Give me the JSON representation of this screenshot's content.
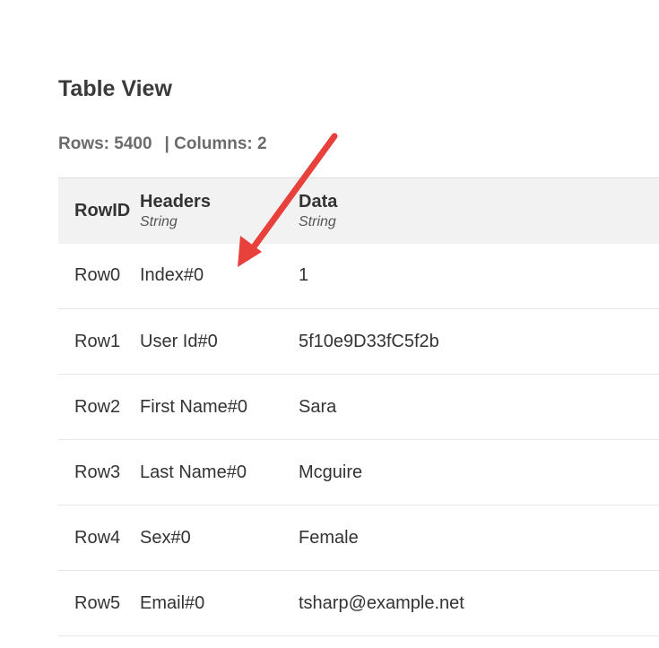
{
  "page": {
    "title": "Table View"
  },
  "summary": {
    "rows": "Rows: 5400",
    "columns": "| Columns: 2"
  },
  "table": {
    "columns": [
      {
        "label": "RowID",
        "type": ""
      },
      {
        "label": "Headers",
        "type": "String"
      },
      {
        "label": "Data",
        "type": "String"
      }
    ],
    "rows": [
      {
        "rowid": "Row0",
        "header": "Index#0",
        "data": "1"
      },
      {
        "rowid": "Row1",
        "header": "User Id#0",
        "data": "5f10e9D33fC5f2b"
      },
      {
        "rowid": "Row2",
        "header": "First Name#0",
        "data": "Sara"
      },
      {
        "rowid": "Row3",
        "header": "Last Name#0",
        "data": "Mcguire"
      },
      {
        "rowid": "Row4",
        "header": "Sex#0",
        "data": "Female"
      },
      {
        "rowid": "Row5",
        "header": "Email#0",
        "data": "tsharp@example.net"
      }
    ]
  },
  "annotation": {
    "arrow_color": "#e8413c",
    "icon": "arrow-icon"
  }
}
